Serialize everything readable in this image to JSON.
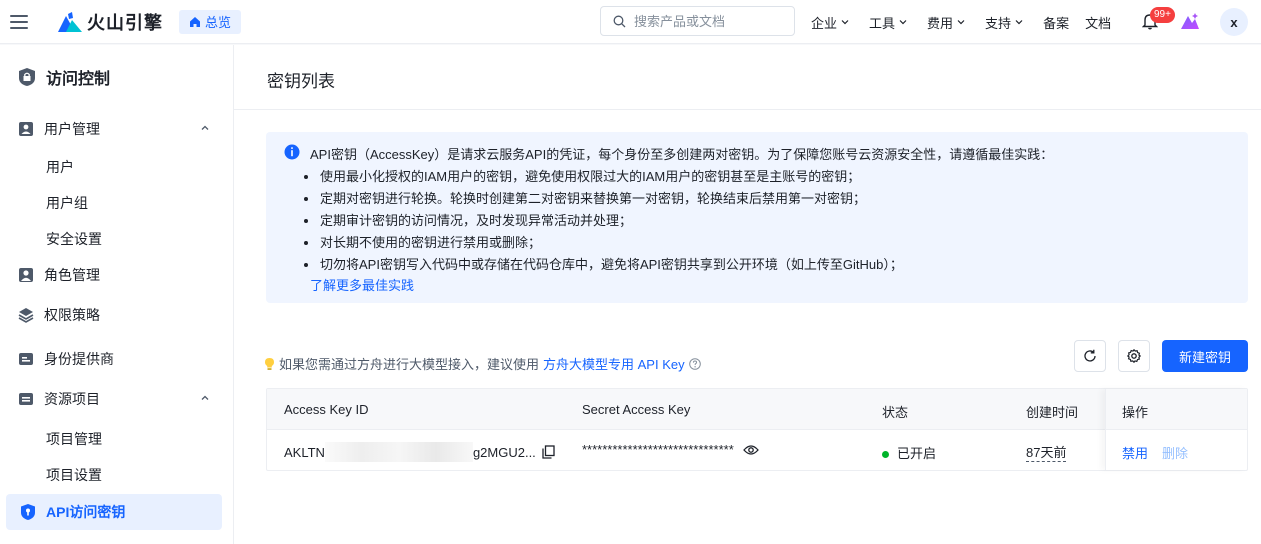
{
  "header": {
    "logo_text": "火山引擎",
    "overview_label": "总览",
    "search_placeholder": "搜索产品或文档",
    "nav": [
      {
        "label": "企业"
      },
      {
        "label": "工具"
      },
      {
        "label": "费用"
      },
      {
        "label": "支持"
      }
    ],
    "nav_plain": [
      "备案",
      "文档"
    ],
    "notification_badge": "99+",
    "avatar_initial": "x"
  },
  "sidebar": {
    "title": "访问控制",
    "groups": {
      "user_mgmt": "用户管理",
      "user_mgmt_items": [
        "用户",
        "用户组",
        "安全设置"
      ],
      "role_mgmt": "角色管理",
      "policy": "权限策略",
      "idp": "身份提供商",
      "resource": "资源项目",
      "resource_items": [
        "项目管理",
        "项目设置"
      ],
      "api_keys": "API访问密钥"
    }
  },
  "main": {
    "title": "密钥列表",
    "info": {
      "head": "API密钥（AccessKey）是请求云服务API的凭证，每个身份至多创建两对密钥。为了保障您账号云资源安全性，请遵循最佳实践：",
      "items": [
        "使用最小化授权的IAM用户的密钥，避免使用权限过大的IAM用户的密钥甚至是主账号的密钥；",
        "定期对密钥进行轮换。轮换时创建第二对密钥来替换第一对密钥，轮换结束后禁用第一对密钥；",
        "定期审计密钥的访问情况，及时发现异常活动并处理；",
        "对长期不使用的密钥进行禁用或删除；",
        "切勿将API密钥写入代码中或存储在代码仓库中，避免将API密钥共享到公开环境（如上传至GitHub）；"
      ],
      "link": "了解更多最佳实践"
    },
    "hint": {
      "text": "如果您需通过方舟进行大模型接入，建议使用",
      "link": "方舟大模型专用 API Key"
    },
    "new_key_button": "新建密钥",
    "table": {
      "headers": {
        "access_key_id": "Access Key ID",
        "secret": "Secret Access Key",
        "status": "状态",
        "created": "创建时间",
        "actions": "操作"
      },
      "rows": [
        {
          "ak_prefix": "AKLTN",
          "ak_suffix": "g2MGU2...",
          "secret": "******************************",
          "status": "已开启",
          "created": "87天前",
          "disable": "禁用",
          "delete": "删除"
        }
      ]
    }
  },
  "colors": {
    "primary": "#1664ff",
    "active_bg": "#e8f0ff",
    "info_bg": "#f0f5ff",
    "status_on": "#00b42a",
    "badge": "#f53f3f"
  }
}
